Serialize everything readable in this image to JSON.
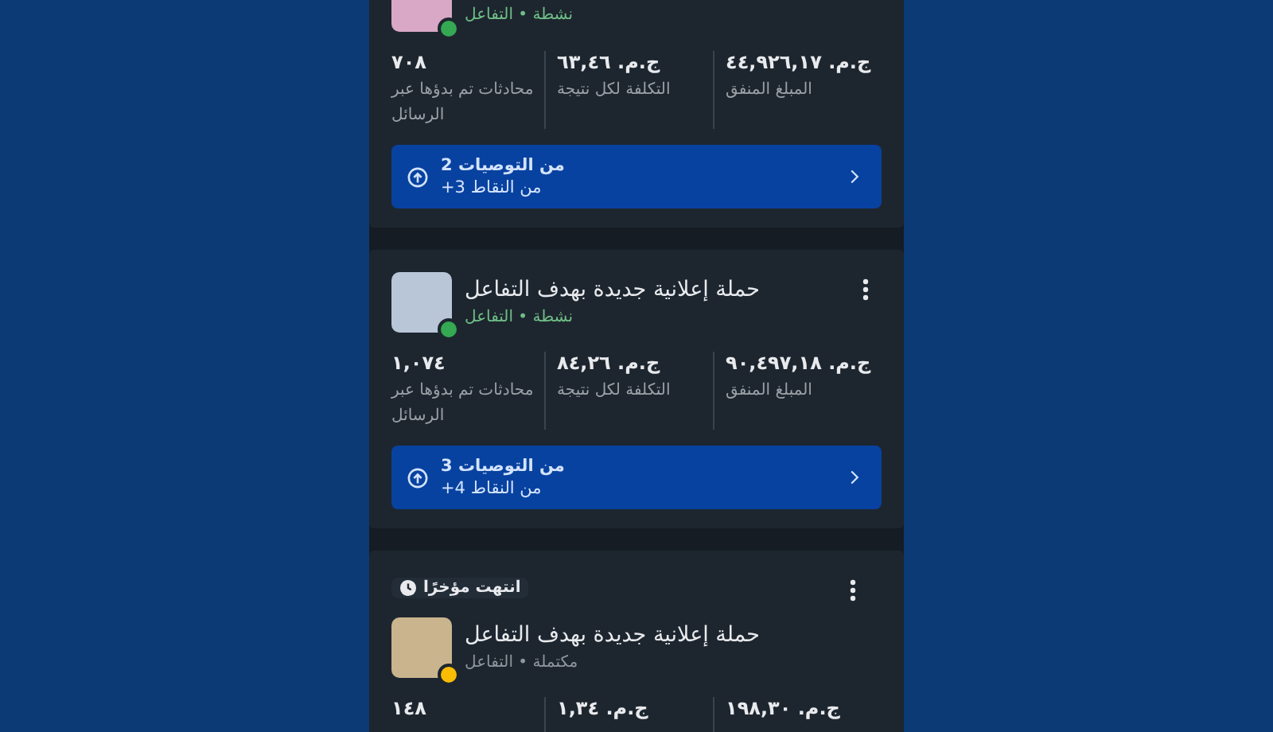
{
  "campaigns": [
    {
      "status": {
        "kind": "active",
        "text": "نشطة • التفاعل",
        "color": "#34a853"
      },
      "metrics": [
        {
          "value": "ج.م. ٤٤,٩٢٦,١٧",
          "label": "المبلغ المنفق"
        },
        {
          "value": "ج.م. ٦٣,٤٦",
          "label": "التكلفة لكل نتيجة"
        },
        {
          "value": "٧٠٨",
          "label": "محادثات تم بدؤها عبر الرسائل"
        }
      ],
      "recommendations": {
        "count": "2 من التوصيات",
        "points": "+3 من النقاط"
      }
    },
    {
      "title": "حملة إعلانية جديدة بهدف التفاعل",
      "status": {
        "kind": "active",
        "text": "نشطة • التفاعل",
        "color": "#34a853"
      },
      "metrics": [
        {
          "value": "ج.م. ٩٠,٤٩٧,١٨",
          "label": "المبلغ المنفق"
        },
        {
          "value": "ج.م. ٨٤,٢٦",
          "label": "التكلفة لكل نتيجة"
        },
        {
          "value": "١,٠٧٤",
          "label": "محادثات تم بدؤها عبر الرسائل"
        }
      ],
      "recommendations": {
        "count": "3 من التوصيات",
        "points": "+4 من النقاط"
      }
    },
    {
      "badge": "انتهت مؤخرًا",
      "title": "حملة إعلانية جديدة بهدف التفاعل",
      "status": {
        "kind": "completed",
        "text": "مكتملة • التفاعل",
        "color": "#fbbc04"
      },
      "metrics": [
        {
          "value": "ج.م. ١٩٨,٣٠"
        },
        {
          "value": "ج.م. ١,٣٤"
        },
        {
          "value": "١٤٨"
        }
      ]
    }
  ]
}
